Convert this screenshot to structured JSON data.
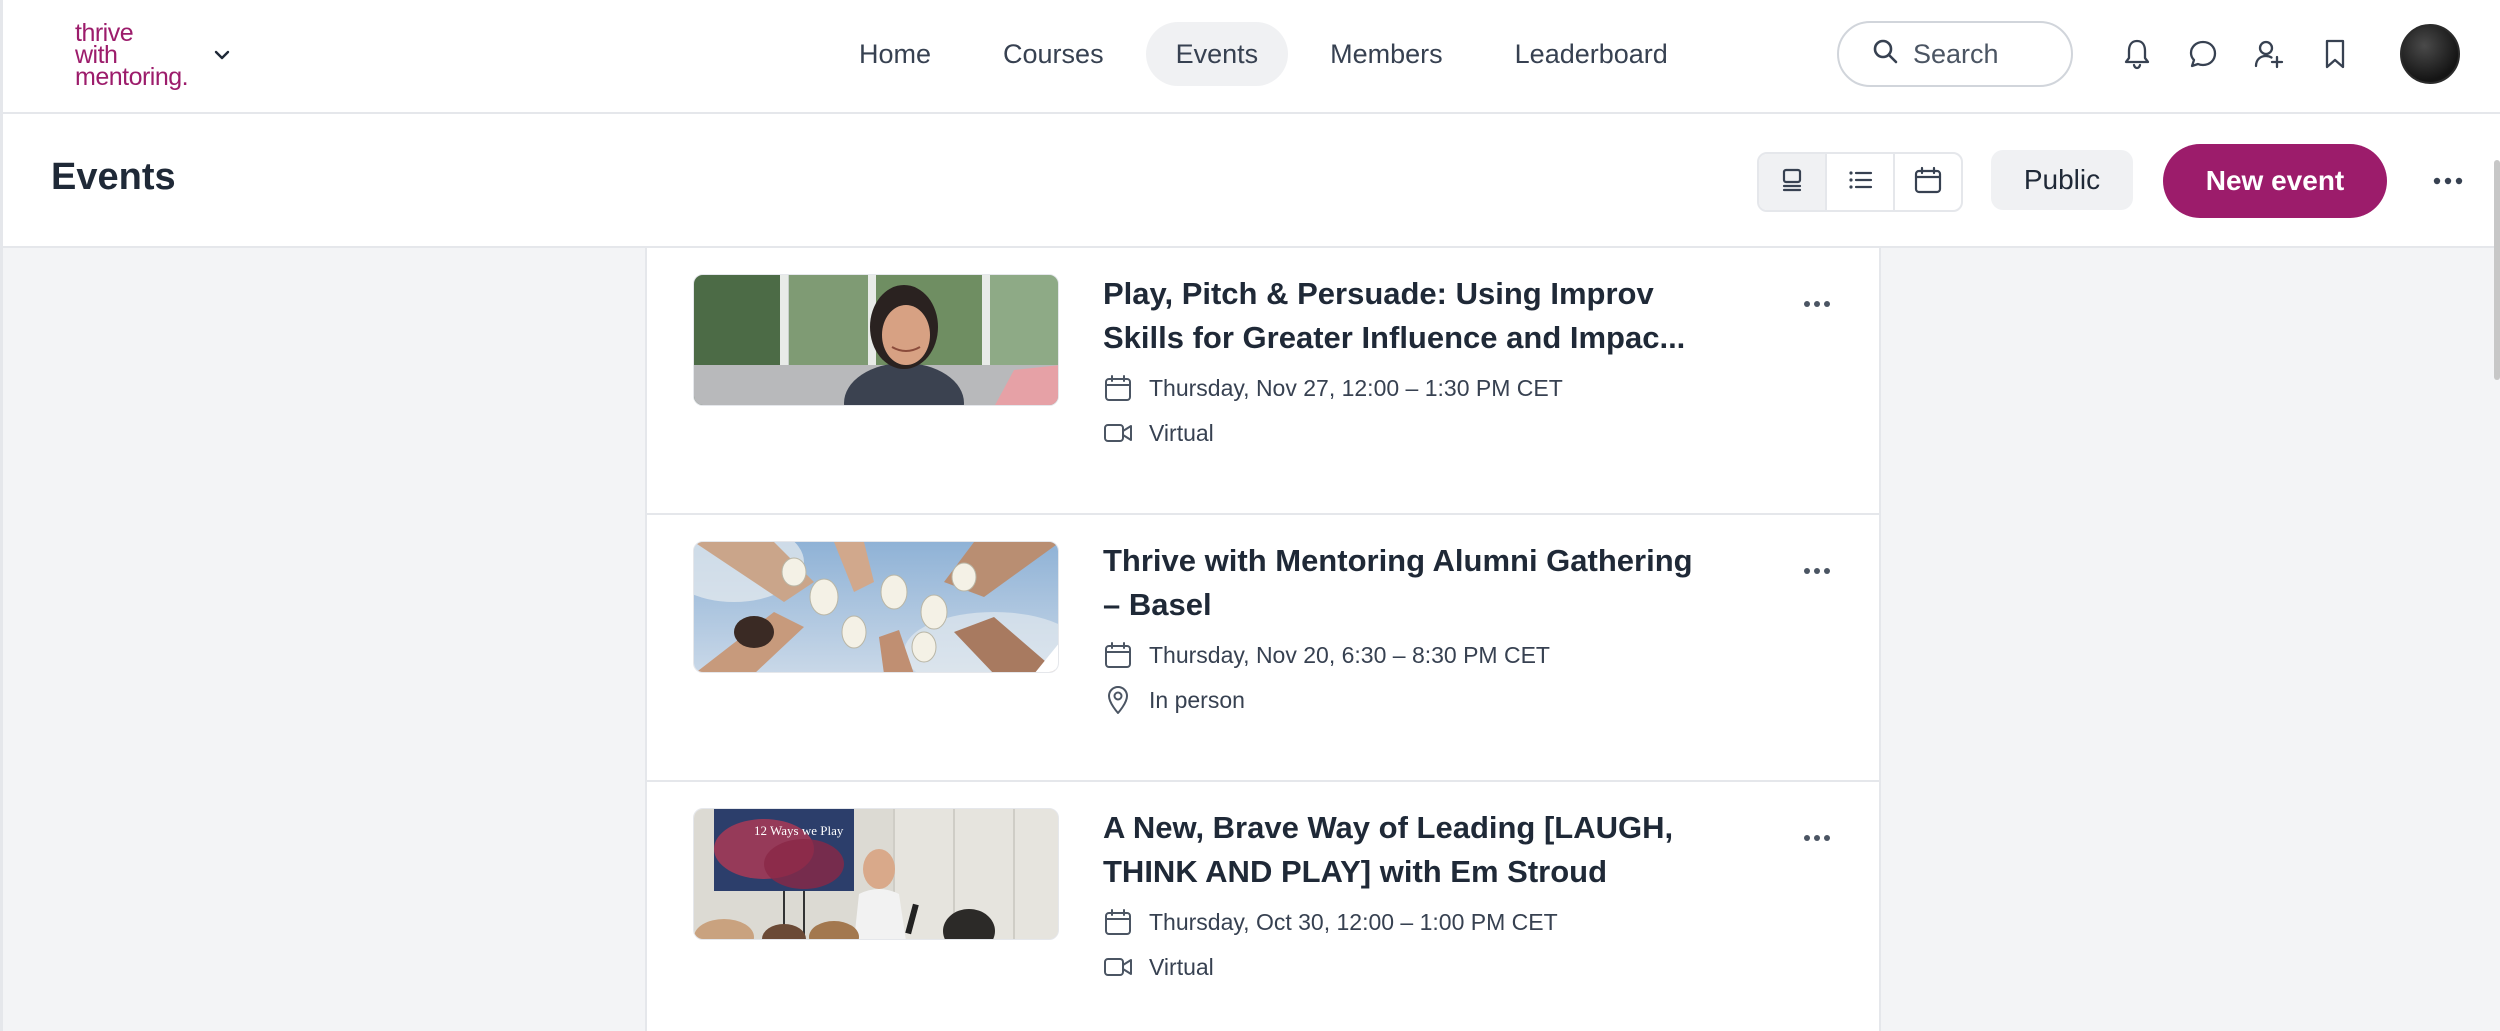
{
  "app": {
    "logo_lines": [
      "thrive",
      "with",
      "mentoring."
    ],
    "brand_color": "#9c1c6b"
  },
  "nav": {
    "items": [
      {
        "label": "Home",
        "active": false
      },
      {
        "label": "Courses",
        "active": false
      },
      {
        "label": "Events",
        "active": true
      },
      {
        "label": "Members",
        "active": false
      },
      {
        "label": "Leaderboard",
        "active": false
      }
    ]
  },
  "search": {
    "placeholder": "Search"
  },
  "header_icons": [
    "bell-icon",
    "chat-bubble-icon",
    "user-add-icon",
    "bookmark-icon"
  ],
  "page": {
    "title": "Events",
    "view_modes": [
      "card-view-icon",
      "list-view-icon",
      "calendar-view-icon"
    ],
    "active_view": "card-view-icon",
    "public_label": "Public",
    "new_event_label": "New event"
  },
  "events": [
    {
      "title": "Play, Pitch & Persuade: Using Improv Skills for Greater Influence and Impac...",
      "date": "Thursday, Nov 27, 12:00 – 1:30 PM CET",
      "location": "Virtual",
      "location_icon": "video-camera-icon"
    },
    {
      "title": "Thrive with Mentoring Alumni Gathering – Basel",
      "date": "Thursday, Nov 20, 6:30 – 8:30 PM CET",
      "location": "In person",
      "location_icon": "map-pin-icon"
    },
    {
      "title": "A New, Brave Way of Leading [LAUGH, THINK AND PLAY] with Em Stroud",
      "date": "Thursday, Oct 30, 12:00 – 1:00 PM CET",
      "location": "Virtual",
      "location_icon": "video-camera-icon",
      "thumb_caption": "12 Ways we Play"
    }
  ]
}
